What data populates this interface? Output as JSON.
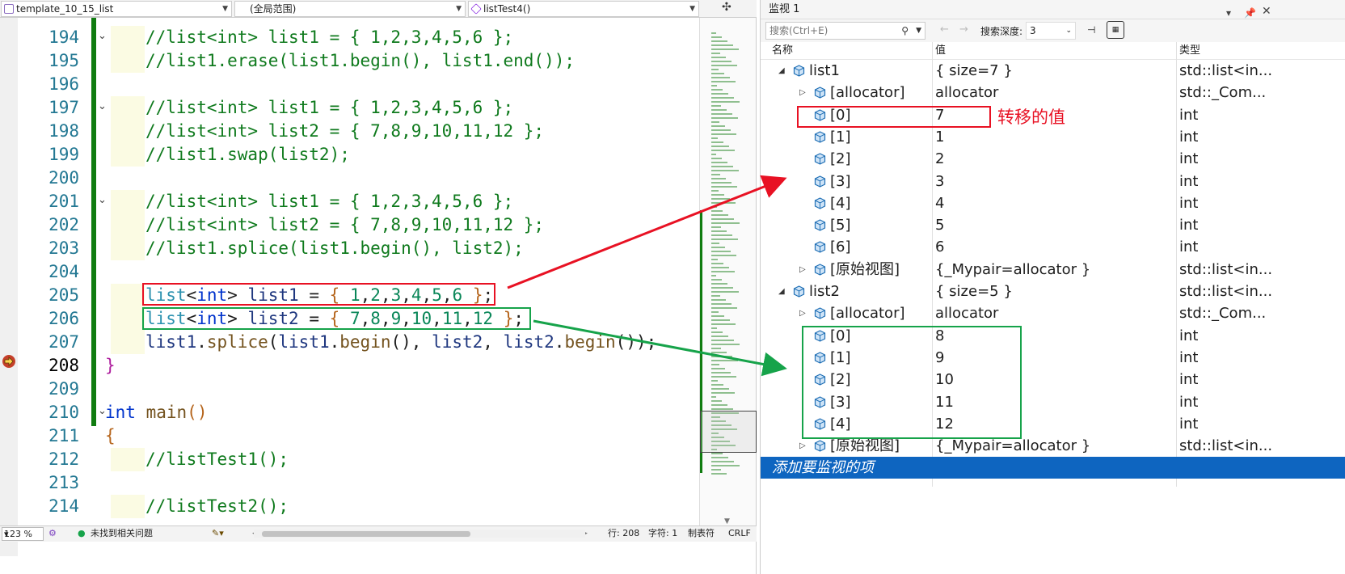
{
  "navbar": {
    "project": "template_10_15_list",
    "scope": "(全局范围)",
    "function": "listTest4()"
  },
  "editor": {
    "lines": [
      {
        "no": "194",
        "text": "//list<int> list1 = { 1,2,3,4,5,6 };",
        "kind": "comment",
        "fold": true
      },
      {
        "no": "195",
        "text": "//list1.erase(list1.begin(), list1.end());",
        "kind": "comment"
      },
      {
        "no": "196",
        "text": "",
        "kind": "blank"
      },
      {
        "no": "197",
        "text": "//list<int> list1 = { 1,2,3,4,5,6 };",
        "kind": "comment",
        "fold": true
      },
      {
        "no": "198",
        "text": "//list<int> list2 = { 7,8,9,10,11,12 };",
        "kind": "comment"
      },
      {
        "no": "199",
        "text": "//list1.swap(list2);",
        "kind": "comment"
      },
      {
        "no": "200",
        "text": "",
        "kind": "blank"
      },
      {
        "no": "201",
        "text": "//list<int> list1 = { 1,2,3,4,5,6 };",
        "kind": "comment",
        "fold": true
      },
      {
        "no": "202",
        "text": "//list<int> list2 = { 7,8,9,10,11,12 };",
        "kind": "comment"
      },
      {
        "no": "203",
        "text": "//list1.splice(list1.begin(), list2);",
        "kind": "comment"
      },
      {
        "no": "204",
        "text": "",
        "kind": "blank"
      },
      {
        "no": "205",
        "text": "list<int> list1 = { 1,2,3,4,5,6 };",
        "kind": "code"
      },
      {
        "no": "206",
        "text": "list<int> list2 = { 7,8,9,10,11,12 };",
        "kind": "code"
      },
      {
        "no": "207",
        "text": "list1.splice(list1.begin(), list2, list2.begin());",
        "kind": "code"
      },
      {
        "no": "208",
        "text": "}",
        "kind": "brace"
      },
      {
        "no": "209",
        "text": "",
        "kind": "blank"
      },
      {
        "no": "210",
        "text": "int main()",
        "kind": "main"
      },
      {
        "no": "211",
        "text": "{",
        "kind": "brace2"
      },
      {
        "no": "212",
        "text": "//listTest1();",
        "kind": "comment"
      },
      {
        "no": "213",
        "text": "",
        "kind": "blank"
      },
      {
        "no": "214",
        "text": "//listTest2();",
        "kind": "comment"
      }
    ],
    "current_line": "208"
  },
  "status": {
    "zoom": "123 %",
    "issues": "未找到相关问题",
    "line": "行: 208",
    "char": "字符: 1",
    "tabs": "制表符",
    "eol": "CRLF"
  },
  "watch": {
    "title": "监视 1",
    "search_placeholder": "搜索(Ctrl+E)",
    "depth_label": "搜索深度:",
    "depth_value": "3",
    "col_name": "名称",
    "col_value": "值",
    "col_type": "类型",
    "rows": [
      {
        "name": "list1",
        "value": "{ size=7 }",
        "type": "std::list<in...",
        "level": 0,
        "expand": "open"
      },
      {
        "name": "[allocator]",
        "value": "allocator",
        "type": "std::_Com...",
        "level": 1,
        "expand": "closed"
      },
      {
        "name": "[0]",
        "value": "7",
        "type": "int",
        "level": 1
      },
      {
        "name": "[1]",
        "value": "1",
        "type": "int",
        "level": 1
      },
      {
        "name": "[2]",
        "value": "2",
        "type": "int",
        "level": 1
      },
      {
        "name": "[3]",
        "value": "3",
        "type": "int",
        "level": 1
      },
      {
        "name": "[4]",
        "value": "4",
        "type": "int",
        "level": 1
      },
      {
        "name": "[5]",
        "value": "5",
        "type": "int",
        "level": 1
      },
      {
        "name": "[6]",
        "value": "6",
        "type": "int",
        "level": 1
      },
      {
        "name": "[原始视图]",
        "value": "{_Mypair=allocator }",
        "type": "std::list<in...",
        "level": 1,
        "expand": "closed"
      },
      {
        "name": "list2",
        "value": "{ size=5 }",
        "type": "std::list<in...",
        "level": 0,
        "expand": "open"
      },
      {
        "name": "[allocator]",
        "value": "allocator",
        "type": "std::_Com...",
        "level": 1,
        "expand": "closed"
      },
      {
        "name": "[0]",
        "value": "8",
        "type": "int",
        "level": 1
      },
      {
        "name": "[1]",
        "value": "9",
        "type": "int",
        "level": 1
      },
      {
        "name": "[2]",
        "value": "10",
        "type": "int",
        "level": 1
      },
      {
        "name": "[3]",
        "value": "11",
        "type": "int",
        "level": 1
      },
      {
        "name": "[4]",
        "value": "12",
        "type": "int",
        "level": 1
      },
      {
        "name": "[原始视图]",
        "value": "{_Mypair=allocator }",
        "type": "std::list<in...",
        "level": 1,
        "expand": "closed"
      }
    ],
    "add_item": "添加要监视的项"
  },
  "annotation": {
    "label": "转移的值",
    "red": "#e81123",
    "green": "#16a34a"
  },
  "colors": {
    "comment": "#0f7a1d",
    "keyword": "#0033cc",
    "selection": "#0e65c0"
  }
}
